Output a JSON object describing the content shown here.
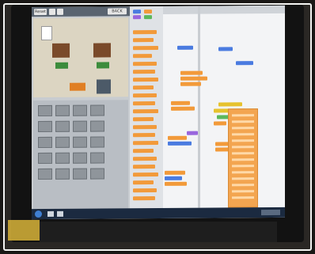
{
  "stage": {
    "toolbar_left_label": "Reset",
    "toolbar_right_label": "BACK"
  },
  "colors": {
    "motion_blocks": "#4a7be0",
    "control_blocks": "#f29a3a",
    "looks_blocks": "#9966dd",
    "events_blocks": "#e6c22e",
    "taskbar": "#1b2a40"
  }
}
